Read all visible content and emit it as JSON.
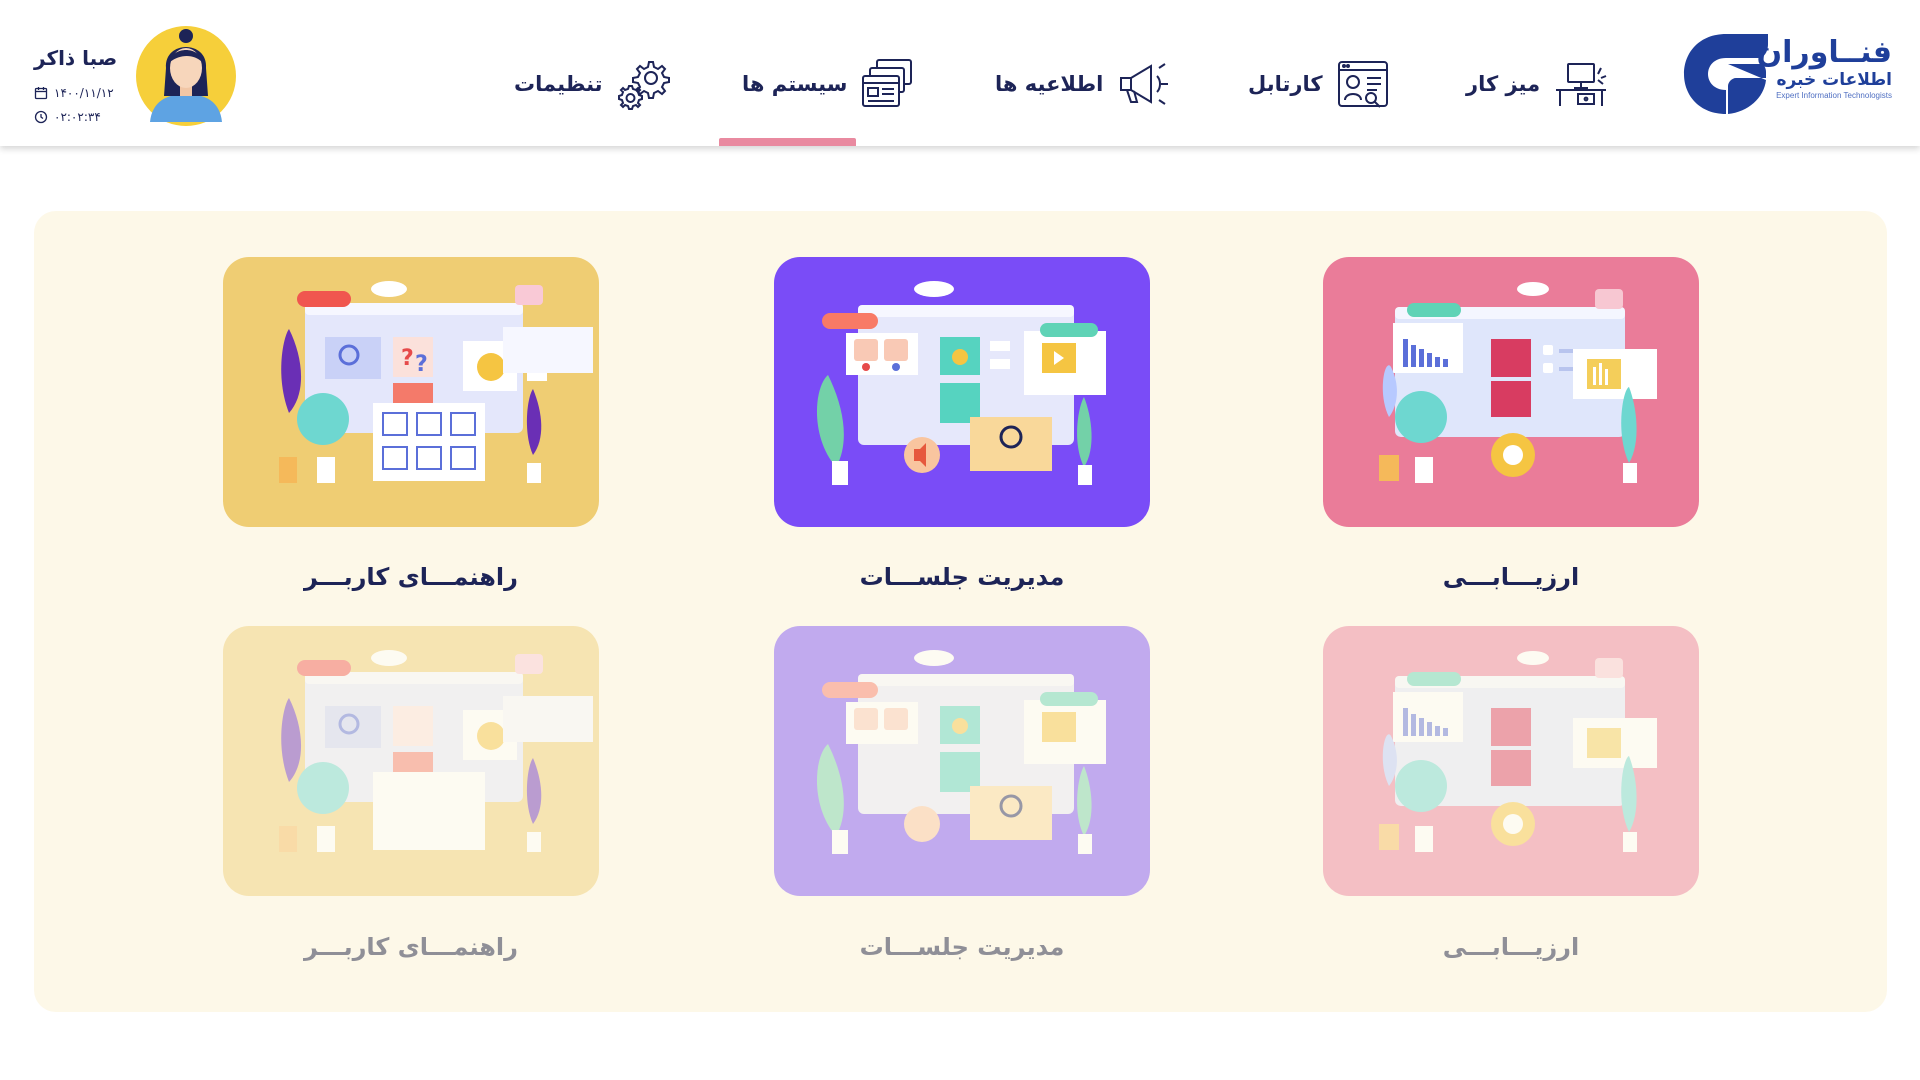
{
  "brand": {
    "name_line1": "فنــاوران",
    "name_line2": "اطلاعات خبره",
    "name_en": "Expert Information Technologists",
    "color": "#1f3f9a"
  },
  "nav": {
    "items": [
      {
        "label": "میز کار",
        "icon": "desk-icon"
      },
      {
        "label": "کارتابل",
        "icon": "cartable-icon"
      },
      {
        "label": "اطلاعیه ها",
        "icon": "megaphone-icon"
      },
      {
        "label": "سیستم ها",
        "icon": "systems-icon",
        "active": true
      },
      {
        "label": "تنظیمات",
        "icon": "gear-icon"
      }
    ],
    "active_color": "#e98aa0"
  },
  "user": {
    "name": "صبا ذاکر",
    "date": "۱۴۰۰/۱۱/۱۲",
    "time": "۰۲:۰۲:۳۴"
  },
  "systems": {
    "row1": [
      {
        "title": "ارزیـــابـــی",
        "color": "#ea7c99"
      },
      {
        "title": "مدیریت جلســـات",
        "color": "#7a4cf7"
      },
      {
        "title": "راهنمـــای کاربـــر",
        "color": "#efcd73"
      }
    ],
    "row2": [
      {
        "title": "ارزیـــابـــی",
        "color": "#f4c1c6"
      },
      {
        "title": "مدیریت جلســـات",
        "color": "#c4abf0"
      },
      {
        "title": "راهنمـــای کاربـــر",
        "color": "#f5dea1"
      }
    ]
  },
  "colors": {
    "panel_bg": "#fdf8e8",
    "text": "#1d2457"
  }
}
